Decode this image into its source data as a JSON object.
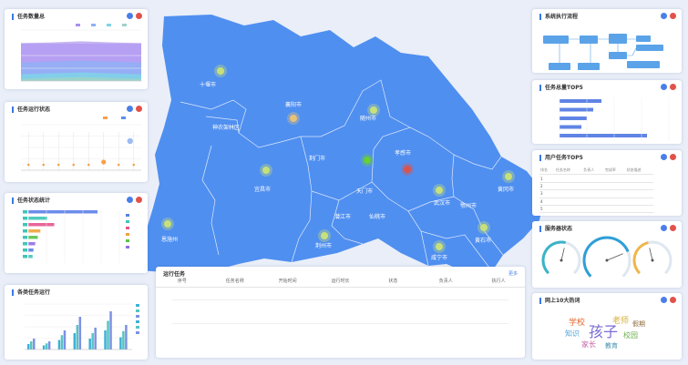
{
  "map": {
    "cities": [
      {
        "name": "十堰市",
        "dot": "#c8e07a"
      },
      {
        "name": "襄阳市",
        "dot": "#e8c27a"
      },
      {
        "name": "神农架林区",
        "dot": null
      },
      {
        "name": "随州市",
        "dot": "#c8e07a"
      },
      {
        "name": "荆门市",
        "dot": "#c8e07a"
      },
      {
        "name": "孝感市",
        "dot": "#d9534f"
      },
      {
        "name": "宜昌市",
        "dot": "#c8e07a"
      },
      {
        "name": "黄冈市",
        "dot": "#c8e07a"
      },
      {
        "name": "天门市",
        "dot": null
      },
      {
        "name": "武汉市",
        "dot": "#c8e07a"
      },
      {
        "name": "潜江市",
        "dot": null
      },
      {
        "name": "仙桃市",
        "dot": null
      },
      {
        "name": "恩施州",
        "dot": "#c8e07a"
      },
      {
        "name": "荆州市",
        "dot": "#c8e07a"
      },
      {
        "name": "鄂州市",
        "dot": null
      },
      {
        "name": "黄石市",
        "dot": "#c8e07a"
      },
      {
        "name": "咸宁市",
        "dot": "#c8e07a"
      }
    ],
    "green_dot_city": "荆门市",
    "green_dot_color": "#6acd3a"
  },
  "panels": {
    "p1": {
      "title": "任务数量总"
    },
    "p2": {
      "title": "任务运行状态"
    },
    "p3": {
      "title": "任务状态统计"
    },
    "p4": {
      "title": "各类任务运行"
    },
    "p5": {
      "title": "系统执行流程"
    },
    "p6": {
      "title": "任务总量TOP5"
    },
    "p7": {
      "title": "用户任务TOP5"
    },
    "p8": {
      "title": "服务器状态"
    },
    "p9": {
      "title": "网上10大热词"
    },
    "task": {
      "title": "运行任务",
      "more": "更多",
      "columns": [
        "序号",
        "任务名称",
        "开始时间",
        "运行时长",
        "状态",
        "负责人",
        "执行人"
      ]
    }
  },
  "chart_data": [
    {
      "type": "area",
      "title": "任务数量总",
      "legend": [
        "",
        "",
        "",
        ""
      ],
      "colors": [
        "#a98ff2",
        "#8fb0f5",
        "#7fd3e8",
        "#9cd4c7"
      ],
      "ylim": [
        0,
        1000
      ],
      "series_levels": [
        760,
        380,
        150,
        60
      ]
    },
    {
      "type": "scatter",
      "title": "任务运行状态",
      "categories": [
        "",
        "",
        "",
        "",
        "",
        "",
        "",
        ""
      ],
      "values": [
        0,
        0,
        0,
        0,
        0,
        120,
        0,
        0
      ],
      "ylim": [
        0,
        2000
      ],
      "legend_colors": [
        "#f5a04a",
        "#5b8fe8"
      ]
    },
    {
      "type": "bar",
      "title": "任务状态统计",
      "orientation": "horizontal",
      "values": [
        400,
        110,
        150,
        70,
        55,
        40,
        30,
        25
      ],
      "xlim": [
        0,
        600
      ],
      "colors": [
        "#5b7fe8",
        "#3fc5b8",
        "#e6548f",
        "#f0a33b",
        "#5ac34d",
        "#8f6fe8"
      ]
    },
    {
      "type": "bar",
      "title": "各类任务运行",
      "values": [
        20,
        15,
        35,
        60,
        40,
        70,
        45
      ],
      "colors": [
        "#3fb0d8",
        "#58c4c2",
        "#7c92e3"
      ],
      "ylim": [
        0,
        500
      ]
    },
    {
      "type": "bar",
      "title": "任务总量TOP5",
      "orientation": "horizontal",
      "values": [
        230,
        185,
        150,
        120,
        480
      ],
      "xlim": [
        0,
        600
      ],
      "color": "#5f84e5"
    }
  ],
  "rank_table": {
    "headers": [
      "排名",
      "任务名称",
      "负责人",
      "完成率",
      "状态描述"
    ],
    "rows": [
      [
        "1",
        "",
        "",
        "",
        ""
      ],
      [
        "2",
        "",
        "",
        "",
        ""
      ],
      [
        "3",
        "",
        "",
        "",
        ""
      ],
      [
        "4",
        "",
        "",
        "",
        ""
      ],
      [
        "5",
        "",
        "",
        "",
        ""
      ]
    ]
  },
  "gauges": [
    {
      "value": 0.55,
      "color": "#3bb3c8"
    },
    {
      "value": 0.75,
      "color": "#2f9fd6"
    },
    {
      "value": 0.45,
      "color": "#f0b64a"
    }
  ],
  "wordcloud": [
    {
      "text": "孩子",
      "color": "#7a6bd6"
    },
    {
      "text": "学校",
      "color": "#e0682f"
    },
    {
      "text": "老师",
      "color": "#d6b13a"
    },
    {
      "text": "知识",
      "color": "#4fa3d6"
    },
    {
      "text": "校园",
      "color": "#6cae4f"
    },
    {
      "text": "家长",
      "color": "#c65fa8"
    },
    {
      "text": "教育",
      "color": "#3c8fb0"
    },
    {
      "text": "假期",
      "color": "#8b6a3a"
    }
  ]
}
